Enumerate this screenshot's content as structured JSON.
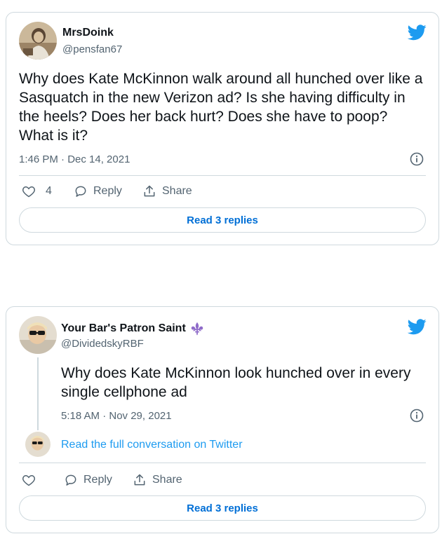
{
  "tweets": [
    {
      "display_name": "MrsDoink",
      "handle": "@pensfan67",
      "text": "Why does Kate McKinnon walk around all hunched over like a Sasquatch in the new Verizon ad? Is she having difficulty in the heels? Does her back hurt? Does she have to poop? What is it?",
      "timestamp": "1:46 PM · Dec 14, 2021",
      "likes": "4",
      "reply_label": "Reply",
      "share_label": "Share",
      "read_replies": "Read 3 replies"
    },
    {
      "display_name": "Your Bar's Patron Saint",
      "handle": "@DividedskyRBF",
      "text": "Why does Kate McKinnon look hunched over in every single cellphone ad",
      "timestamp": "5:18 AM · Nov 29, 2021",
      "full_conversation": "Read the full conversation on Twitter",
      "reply_label": "Reply",
      "share_label": "Share",
      "read_replies": "Read 3 replies"
    }
  ],
  "colors": {
    "twitter_blue": "#1d9bf0",
    "link_blue": "#006fd6",
    "muted_text": "#536471",
    "border": "#cfd9de",
    "fleur_de_lis": "#8f6bc9"
  },
  "icons": [
    "twitter-bird-icon",
    "info-icon",
    "heart-icon",
    "reply-bubble-icon",
    "share-icon",
    "fleur-de-lis-emoji"
  ]
}
